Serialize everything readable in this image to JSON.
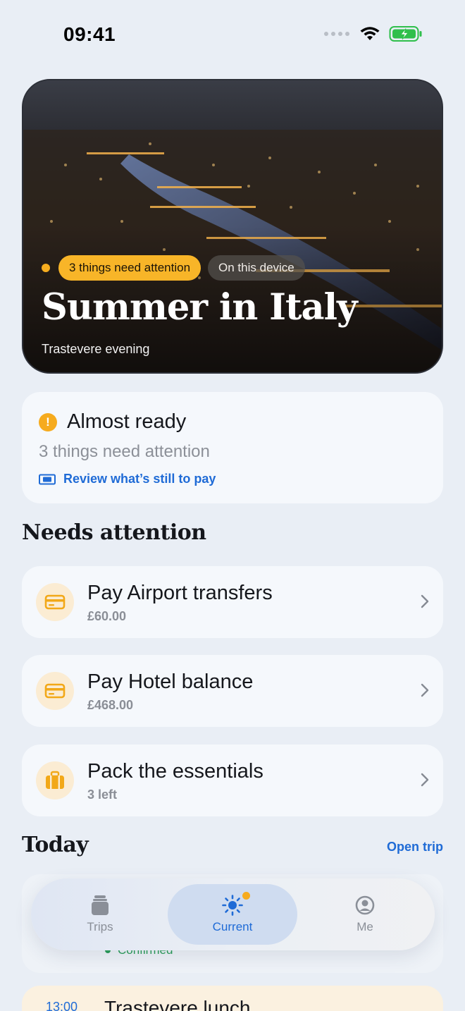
{
  "status_bar": {
    "time": "09:41"
  },
  "hero": {
    "attention_pill": "3 things need attention",
    "device_pill": "On this device",
    "title": "Summer in Italy",
    "subtitle": "Trastevere evening"
  },
  "status_card": {
    "title": "Almost ready",
    "subtitle": "3 things need attention",
    "link": "Review what’s still to pay"
  },
  "needs_attention": {
    "heading": "Needs attention",
    "items": [
      {
        "title": "Pay Airport transfers",
        "subtitle": "£60.00",
        "icon": "card-icon"
      },
      {
        "title": "Pay Hotel balance",
        "subtitle": "£468.00",
        "icon": "card-icon"
      },
      {
        "title": "Pack the essentials",
        "subtitle": "3 left",
        "icon": "suitcase-icon"
      }
    ]
  },
  "today": {
    "heading": "Today",
    "open_link": "Open trip",
    "first_status": "Confirmed",
    "second_time": "13:00",
    "second_title": "Trastevere lunch"
  },
  "tab_bar": {
    "tabs": [
      {
        "label": "Trips",
        "icon": "trips-icon"
      },
      {
        "label": "Current",
        "icon": "sun-icon",
        "active": true
      },
      {
        "label": "Me",
        "icon": "profile-icon"
      }
    ]
  },
  "colors": {
    "accent": "#1f6bd6",
    "warning": "#f6ab1e",
    "background": "#e9eef5",
    "success": "#2a9d57"
  }
}
